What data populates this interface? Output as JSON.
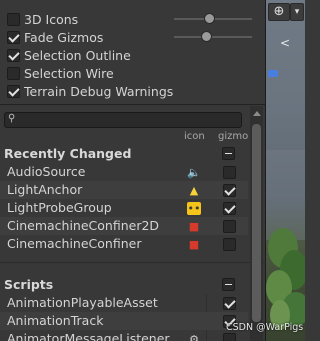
{
  "options": [
    {
      "label": "3D Icons",
      "checked": false
    },
    {
      "label": "Fade Gizmos",
      "checked": true
    },
    {
      "label": "Selection Outline",
      "checked": true
    },
    {
      "label": "Selection Wire",
      "checked": false
    },
    {
      "label": "Terrain Debug Warnings",
      "checked": true
    }
  ],
  "sliders": {
    "icon_size": 0.45,
    "fade_distance": 0.4
  },
  "search": {
    "placeholder": ""
  },
  "columns": {
    "icon": "icon",
    "gizmo": "gizmo"
  },
  "recently_changed": {
    "title": "Recently Changed",
    "items": [
      {
        "name": "AudioSource",
        "icon": "speaker-icon",
        "gizmo": false
      },
      {
        "name": "LightAnchor",
        "icon": "light-flare-icon",
        "gizmo": true
      },
      {
        "name": "LightProbeGroup",
        "icon": "light-probe-icon",
        "gizmo": true
      },
      {
        "name": "CinemachineConfiner2D",
        "icon": "cinemachine-icon",
        "gizmo": false
      },
      {
        "name": "CinemachineConfiner",
        "icon": "cinemachine-icon",
        "gizmo": false
      }
    ]
  },
  "scripts": {
    "title": "Scripts",
    "items": [
      {
        "name": "AnimationPlayableAsset",
        "gizmo": true
      },
      {
        "name": "AnimationTrack",
        "gizmo": true
      },
      {
        "name": "AnimatorMessageListener",
        "gizmo": false
      }
    ]
  },
  "scene": {
    "axis_label": "<"
  },
  "watermark": "CSDN @WarPigs",
  "colors": {
    "panel_bg": "#383838",
    "scene_blue_axis": "#4a7ede",
    "audio_icon": "#f0b21a",
    "cinemachine_icon": "#d63a2a"
  }
}
